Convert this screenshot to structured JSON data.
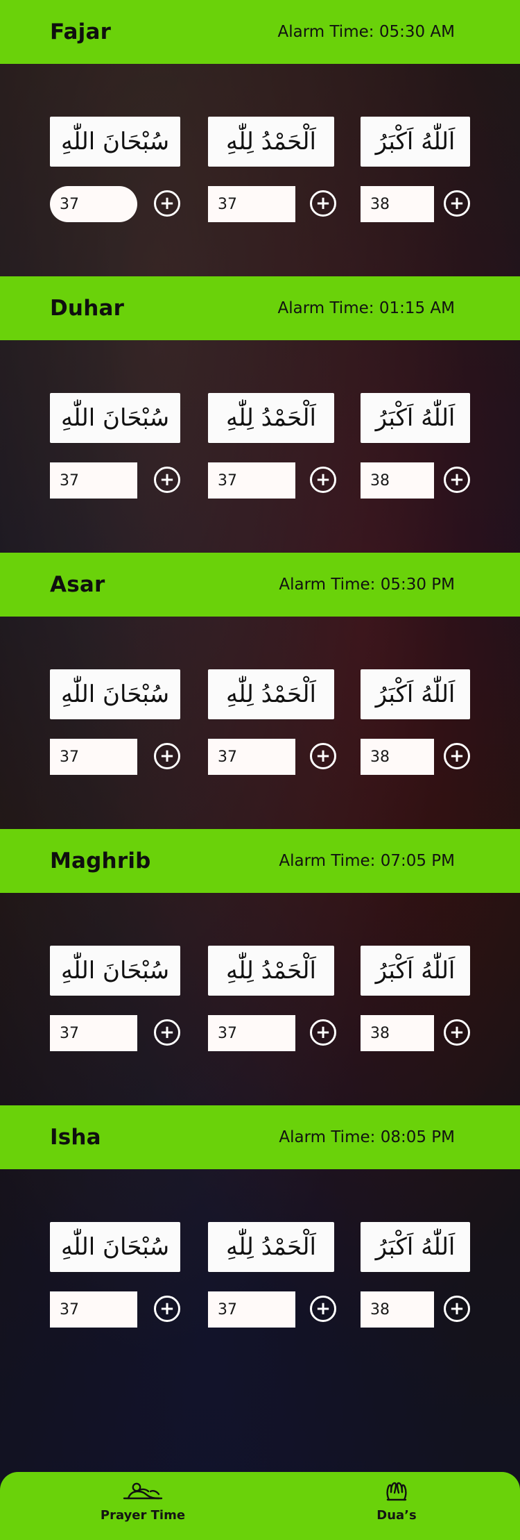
{
  "theme": {
    "accent": "#6ad20a",
    "text_dark": "#111111",
    "card_bg": "#fbfbfb",
    "input_bg": "#fffaf9"
  },
  "dhikr": {
    "subhanallah": "سُبْحَانَ اللّٰهِ",
    "alhamdulillah": "اَلْحَمْدُ لِلّٰهِ",
    "allahuakbar": "اَللّٰهُ اَكْبَرُ"
  },
  "prayers": [
    {
      "name": "Fajar",
      "alarm": "Alarm Time: 05:30 AM",
      "counts": {
        "subhanallah": "37",
        "alhamdulillah": "37",
        "allahuakbar": "38"
      }
    },
    {
      "name": "Duhar",
      "alarm": "Alarm Time: 01:15 AM",
      "counts": {
        "subhanallah": "37",
        "alhamdulillah": "37",
        "allahuakbar": "38"
      }
    },
    {
      "name": "Asar",
      "alarm": "Alarm Time: 05:30 PM",
      "counts": {
        "subhanallah": "37",
        "alhamdulillah": "37",
        "allahuakbar": "38"
      }
    },
    {
      "name": "Maghrib",
      "alarm": "Alarm Time: 07:05 PM",
      "counts": {
        "subhanallah": "37",
        "alhamdulillah": "37",
        "allahuakbar": "38"
      }
    },
    {
      "name": "Isha",
      "alarm": "Alarm Time: 08:05 PM",
      "counts": {
        "subhanallah": "37",
        "alhamdulillah": "37",
        "allahuakbar": "38"
      }
    }
  ],
  "bottom_nav": {
    "prayer_time": {
      "label": "Prayer Time",
      "icon": "prayer-icon"
    },
    "duas": {
      "label": "Dua’s",
      "icon": "dua-hands-icon"
    }
  },
  "icons": {
    "increment": "plus-circle-icon"
  }
}
